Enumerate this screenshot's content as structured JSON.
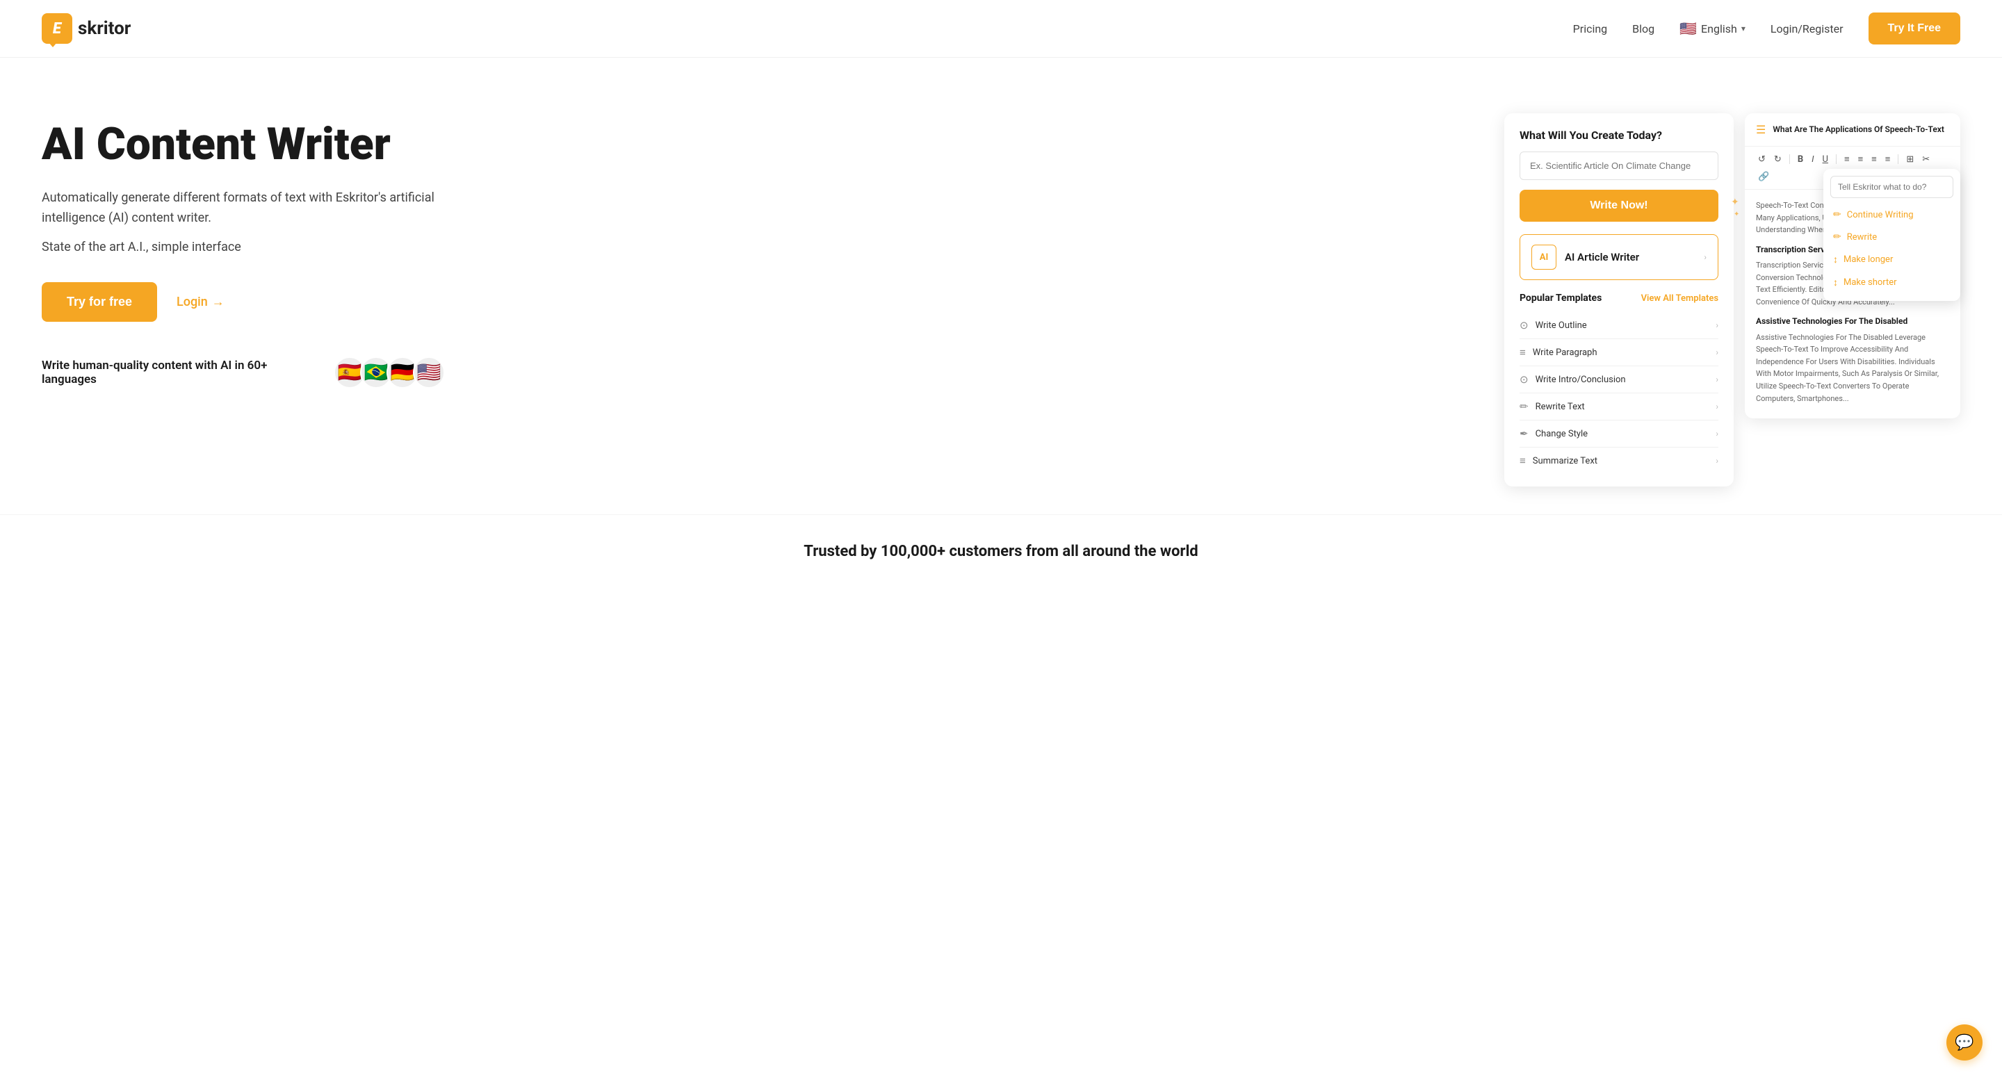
{
  "brand": {
    "logo_letter": "E",
    "logo_name": "skritor"
  },
  "navbar": {
    "pricing_label": "Pricing",
    "blog_label": "Blog",
    "language_label": "English",
    "language_flag": "🇺🇸",
    "login_register_label": "Login/Register",
    "try_free_label": "Try It Free"
  },
  "hero": {
    "title": "AI Content Writer",
    "desc": "Automatically generate different formats of text with Eskritor's artificial intelligence (AI) content writer.",
    "sub": "State of the art A.I., simple interface",
    "cta_primary": "Try for free",
    "cta_secondary": "Login",
    "langs_text": "Write human-quality content with AI in 60+ languages",
    "flags": [
      "🇪🇸",
      "🇧🇷",
      "🇩🇪",
      "🇺🇸"
    ]
  },
  "creator_card": {
    "title": "What Will You Create Today?",
    "input_placeholder": "Ex. Scientific Article On Climate Change",
    "write_now_label": "Write Now!",
    "ai_writer_label": "AI Article Writer",
    "popular_templates": "Popular Templates",
    "view_all": "View All Templates",
    "templates": [
      {
        "icon": "⊙",
        "label": "Write Outline"
      },
      {
        "icon": "≡",
        "label": "Write Paragraph"
      },
      {
        "icon": "⊙",
        "label": "Write Intro/Conclusion"
      },
      {
        "icon": "✏",
        "label": "Rewrite Text"
      },
      {
        "icon": "✒",
        "label": "Change Style"
      },
      {
        "icon": "≡",
        "label": "Summarize Text"
      }
    ]
  },
  "editor_card": {
    "title": "What Are The Applications Of Speech-To-Text",
    "toolbar": [
      "↺",
      "↻",
      "B",
      "I",
      "U",
      "≡",
      "≡",
      "≡",
      "≡",
      "≡",
      "⊞",
      "✂",
      "🔗"
    ],
    "content_intro": "Speech-To-Text Conversion Has Become Integral To Many Applications, Used In Various Ways, And Understanding Where Crucial Information...",
    "section1_title": "Transcription Services",
    "section1_text": "Transcription Services Leverage Speech-To-Text Conversion Technologies. Spoken Audio Into Written Text Efficiently. Editors Benefit Also From The Convenience Of Quickly And Accurately...",
    "section2_title": "Assistive Technologies For The Disabled",
    "section2_text": "Assistive Technologies For The Disabled Leverage Speech-To-Text To Improve Accessibility And Independence For Users With Disabilities. Individuals With Motor Impairments, Such As Paralysis Or Similar, Utilize Speech-To-Text Converters To Operate Computers, Smartphones..."
  },
  "ai_popup": {
    "placeholder": "Tell Eskritor what to do?",
    "items": [
      {
        "icon": "✏",
        "label": "Continue Writing"
      },
      {
        "icon": "✏",
        "label": "Rewrite"
      },
      {
        "icon": "↕",
        "label": "Make longer"
      },
      {
        "icon": "↕",
        "label": "Make shorter"
      }
    ]
  },
  "trusted": {
    "text": "Trusted by 100,000+ customers from all around the world"
  },
  "chat": {
    "icon": "💬"
  }
}
